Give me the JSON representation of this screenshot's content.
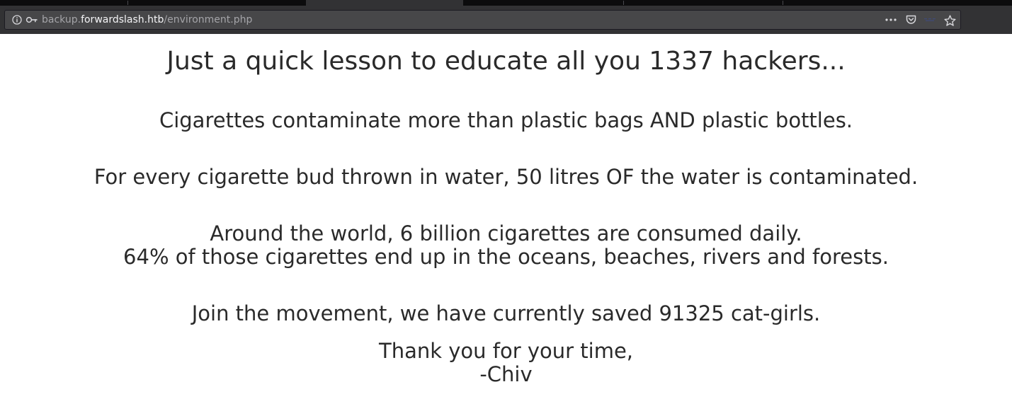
{
  "browser": {
    "url_host_prefix": "backup.",
    "url_host_main": "forwardslash.htb",
    "url_path": "/environment.php",
    "icons": {
      "info": "info-icon",
      "key": "key-icon",
      "menu": "page-actions-icon",
      "pocket": "pocket-icon",
      "reader": "reader-mode-icon",
      "bookmark": "bookmark-star-icon"
    }
  },
  "page": {
    "heading": "Just a quick lesson to educate all you 1337 hackers...",
    "line1": "Cigarettes contaminate more than plastic bags AND plastic bottles.",
    "line2": "For every cigarette bud thrown in water, 50 litres OF the water is contaminated.",
    "line3a": "Around the world, 6 billion cigarettes are consumed daily.",
    "line3b": "64% of those cigarettes end up in the oceans, beaches, rivers and forests.",
    "line4": "Join the movement, we have currently saved 91325 cat-girls.",
    "closing": "Thank you for your time,",
    "signature": "-Chiv"
  },
  "colors": {
    "text": "#2a2a2a",
    "chrome_bg": "#323234",
    "urlbar_bg": "#474749"
  }
}
